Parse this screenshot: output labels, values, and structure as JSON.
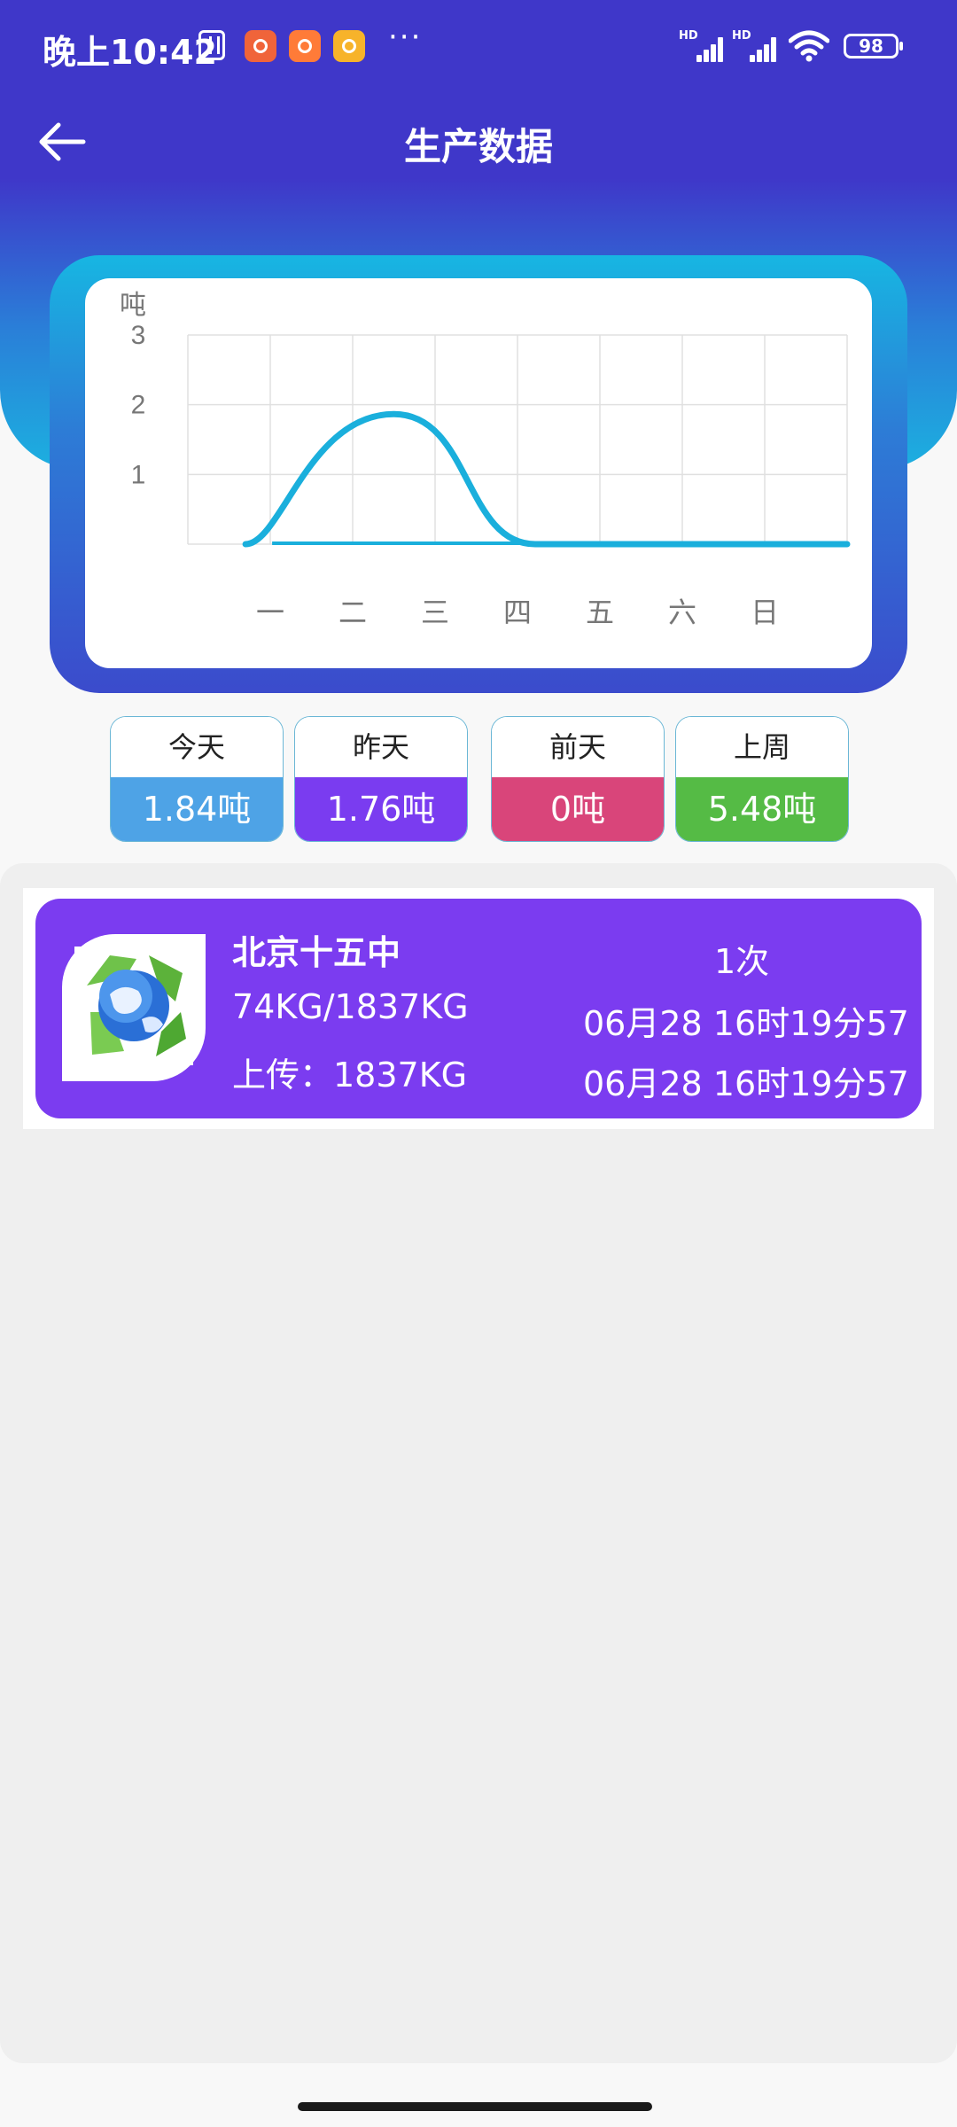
{
  "status_bar": {
    "time": "晚上10:42",
    "hd_label": "HD",
    "battery": "98"
  },
  "nav": {
    "title": "生产数据"
  },
  "chart_data": {
    "type": "line",
    "ylabel": "吨",
    "yticks": [
      "1",
      "2",
      "3"
    ],
    "ylim": [
      0,
      3
    ],
    "categories": [
      "一",
      "二",
      "三",
      "四",
      "五",
      "六",
      "日"
    ],
    "series": [
      {
        "values": [
          0,
          1.84,
          1.76,
          0,
          0,
          0,
          0
        ]
      }
    ],
    "grid": true,
    "color": "#1aafdc"
  },
  "stats": [
    {
      "label": "今天",
      "value": "1.84吨",
      "color": "#4ea3e6"
    },
    {
      "label": "昨天",
      "value": "1.76吨",
      "color": "#7a3cf0"
    },
    {
      "label": "前天",
      "value": "0吨",
      "color": "#d9457a"
    },
    {
      "label": "上周",
      "value": "5.48吨",
      "color": "#55bb45"
    }
  ],
  "records": [
    {
      "name": "北京十五中",
      "weight": "74KG/1837KG",
      "upload": "上传：1837KG",
      "count": "1次",
      "time_1": "06月28 16时19分57",
      "time_2": "06月28 16时19分57"
    }
  ]
}
